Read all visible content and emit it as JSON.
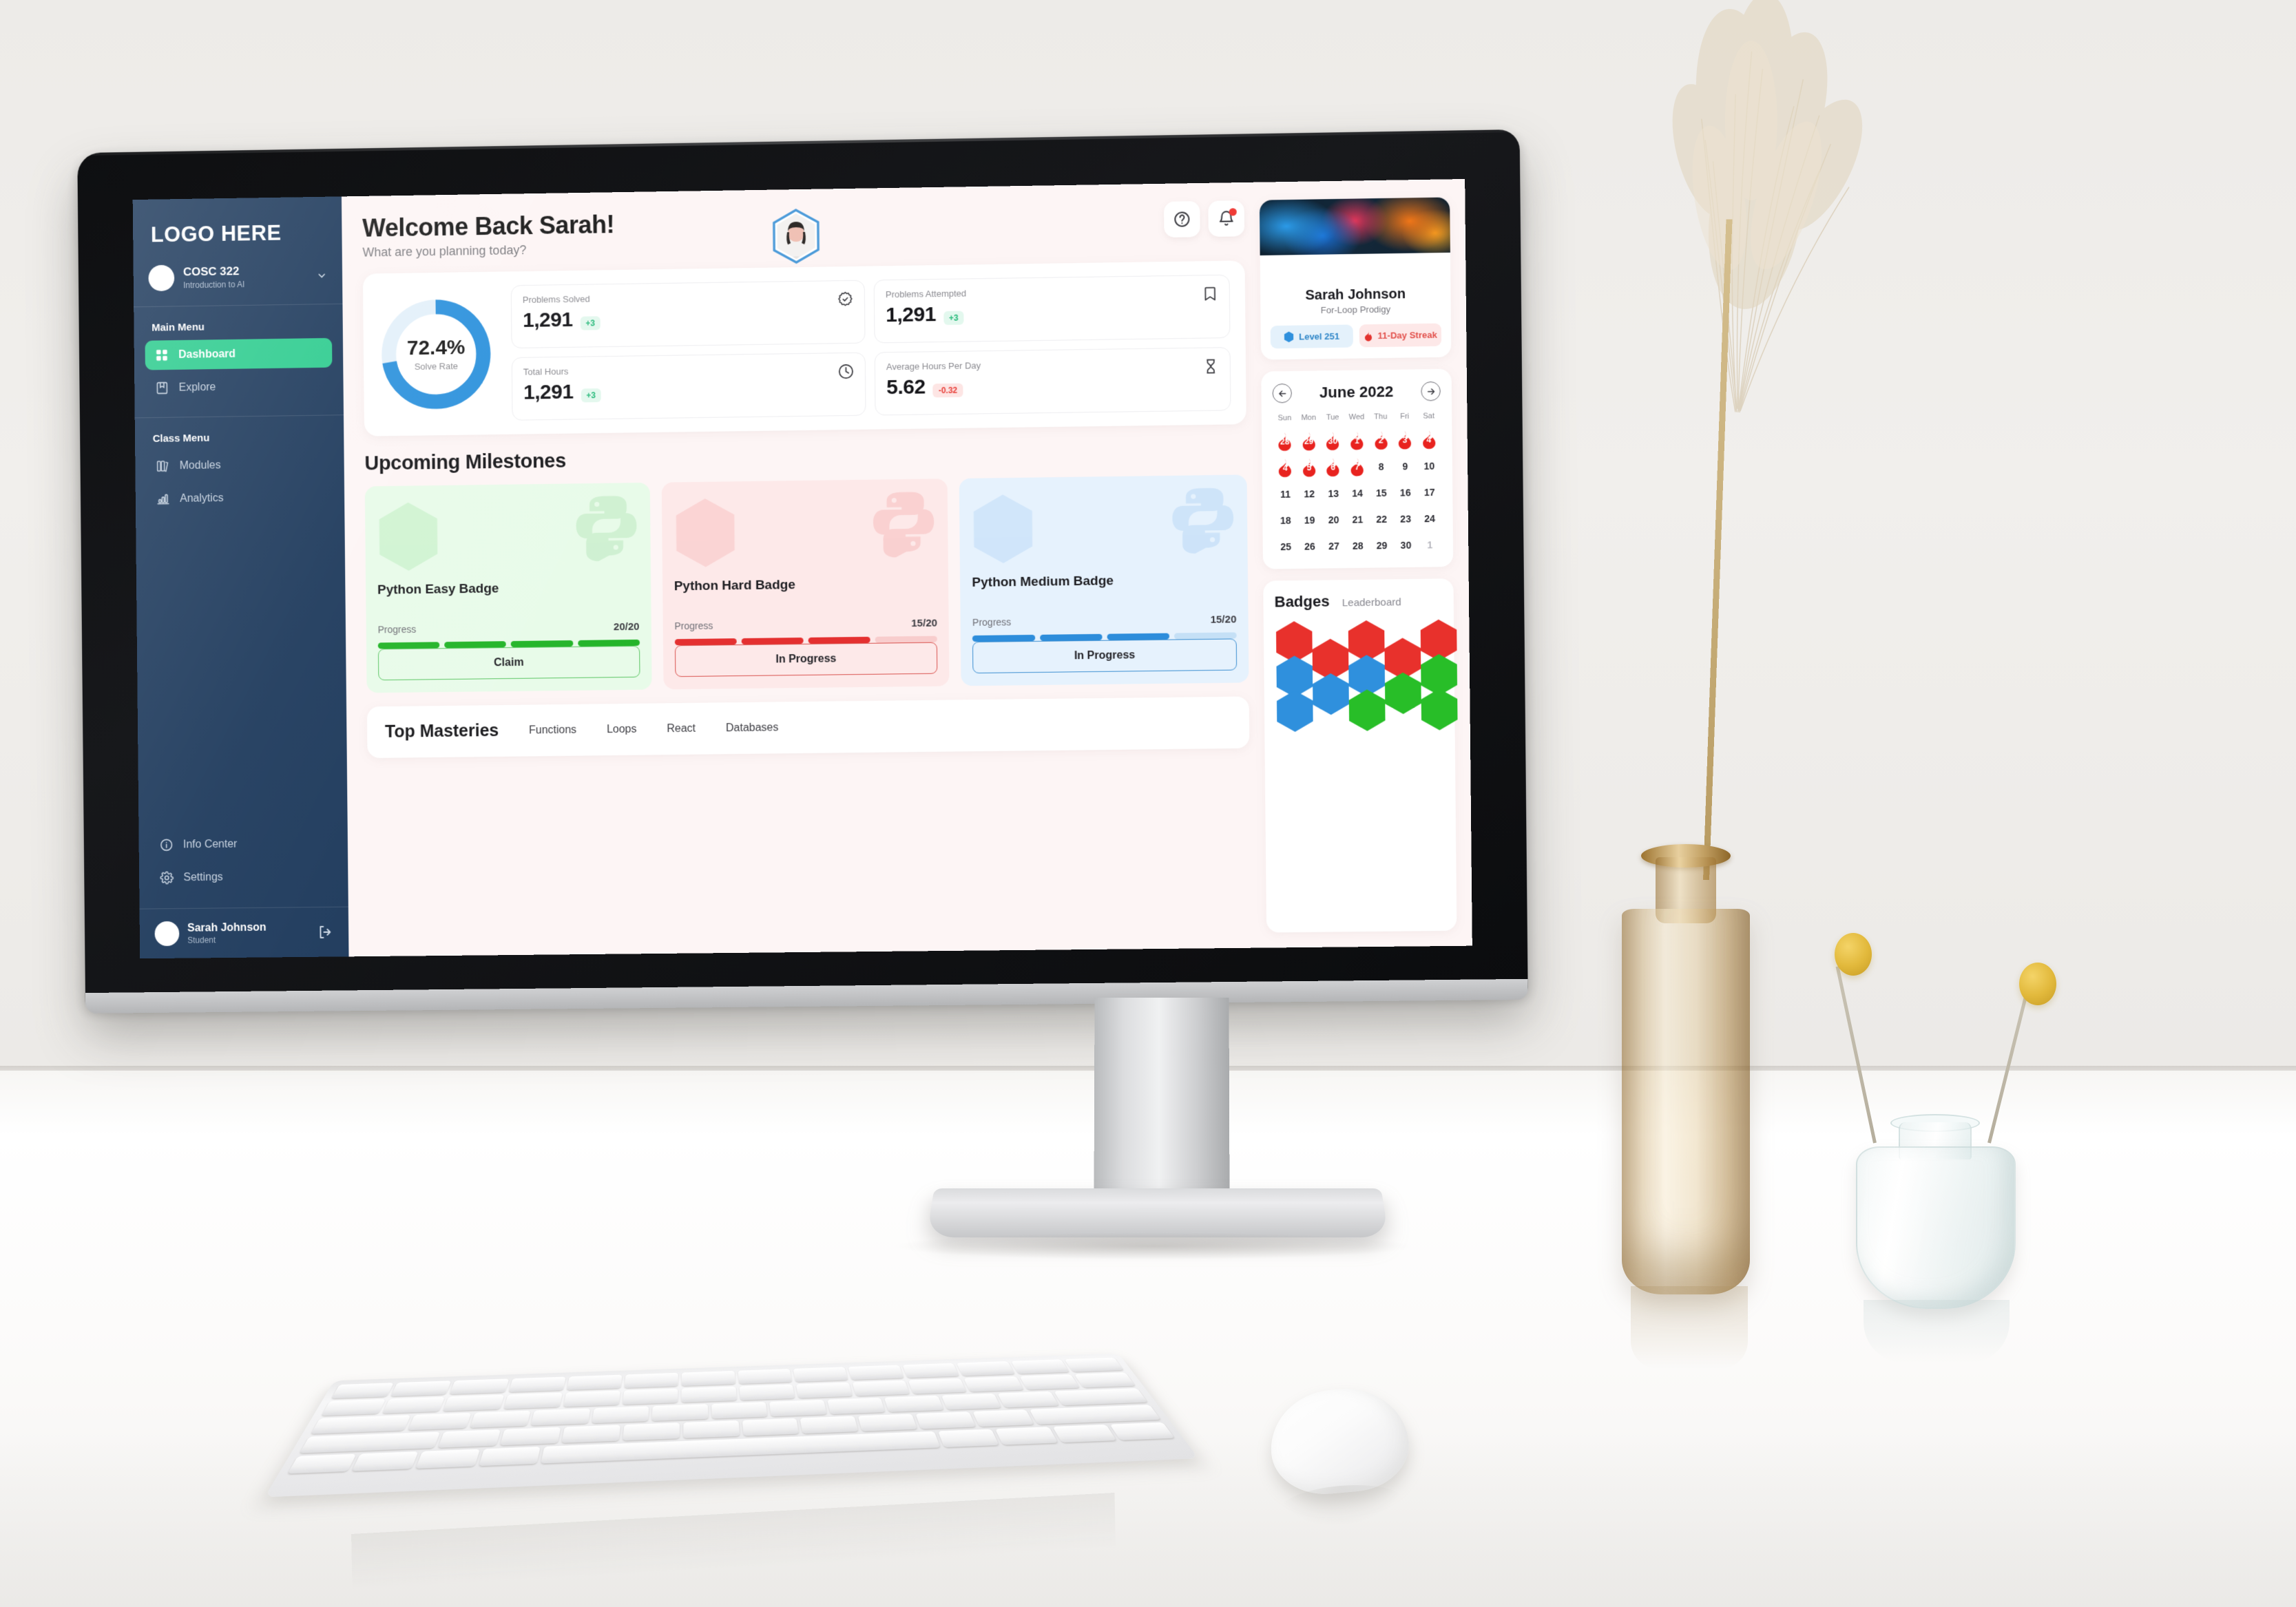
{
  "sidebar": {
    "logo": "LOGO HERE",
    "course": {
      "code": "COSC 322",
      "name": "Introduction to AI"
    },
    "sections": [
      {
        "title": "Main Menu",
        "items": [
          {
            "label": "Dashboard",
            "icon": "grid-icon",
            "active": true
          },
          {
            "label": "Explore",
            "icon": "book-bookmark-icon",
            "active": false
          }
        ]
      },
      {
        "title": "Class Menu",
        "items": [
          {
            "label": "Modules",
            "icon": "books-icon",
            "active": false
          },
          {
            "label": "Analytics",
            "icon": "bar-chart-icon",
            "active": false
          }
        ]
      }
    ],
    "bottom_items": [
      {
        "label": "Info Center",
        "icon": "info-icon"
      },
      {
        "label": "Settings",
        "icon": "gear-icon"
      }
    ],
    "user": {
      "name": "Sarah Johnson",
      "role": "Student"
    },
    "accent_active": "#2ecc8f",
    "bg": "#1e3a5c"
  },
  "header": {
    "title": "Welcome Back Sarah!",
    "subtitle": "What are you planning today?",
    "help_icon": "help-circle-icon",
    "notification_icon": "bell-icon",
    "has_notification": true
  },
  "stats": {
    "donut": {
      "value": "72.4%",
      "label": "Solve Rate",
      "percent": 72.4,
      "color": "#2f93dd",
      "track": "#e3f0fa"
    },
    "cards": [
      {
        "label": "Problems Solved",
        "value": "1,291",
        "delta": "+3",
        "delta_dir": "up",
        "icon": "verified-check-icon"
      },
      {
        "label": "Problems Attempted",
        "value": "1,291",
        "delta": "+3",
        "delta_dir": "up",
        "icon": "bookmark-icon"
      },
      {
        "label": "Total Hours",
        "value": "1,291",
        "delta": "+3",
        "delta_dir": "up",
        "icon": "clock-icon"
      },
      {
        "label": "Average Hours Per Day",
        "value": "5.62",
        "delta": "-0.32",
        "delta_dir": "down",
        "icon": "hourglass-icon"
      }
    ]
  },
  "milestones": {
    "title": "Upcoming Milestones",
    "cards": [
      {
        "name": "Python Easy Badge",
        "progress_label": "Progress",
        "progress_value": "20/20",
        "segments_total": 4,
        "segments_filled": 4,
        "button": "Claim",
        "bg": "#e8fbe9",
        "accent": "#22b428",
        "track": "#c9f0cb",
        "border": "#5bc563"
      },
      {
        "name": "Python Hard Badge",
        "progress_label": "Progress",
        "progress_value": "15/20",
        "segments_total": 4,
        "segments_filled": 3,
        "button": "In Progress",
        "bg": "#fde9e9",
        "accent": "#e43030",
        "track": "#f8cdcd",
        "border": "#d9534f"
      },
      {
        "name": "Python Medium Badge",
        "progress_label": "Progress",
        "progress_value": "15/20",
        "segments_total": 4,
        "segments_filled": 3,
        "button": "In Progress",
        "bg": "#e6f2fd",
        "accent": "#2d8ddb",
        "track": "#c5e0f6",
        "border": "#3d8fd1"
      }
    ]
  },
  "masteries": {
    "title": "Top Masteries",
    "items": [
      "Functions",
      "Loops",
      "React",
      "Databases"
    ]
  },
  "profile": {
    "name": "Sarah Johnson",
    "role": "For-Loop Prodigy",
    "badges": [
      {
        "label": "Level 251",
        "icon": "hex-level-icon",
        "color": "#2f86c8"
      },
      {
        "label": "11-Day Streak",
        "icon": "flame-icon",
        "color": "#e2504b"
      }
    ]
  },
  "calendar": {
    "month": "June 2022",
    "prev_icon": "arrow-left-icon",
    "next_icon": "arrow-right-icon",
    "dow": [
      "Sun",
      "Mon",
      "Tue",
      "Wed",
      "Thu",
      "Fri",
      "Sat"
    ],
    "weeks": [
      [
        {
          "d": "28",
          "fire": true,
          "muted": true
        },
        {
          "d": "29",
          "fire": true,
          "muted": true
        },
        {
          "d": "30",
          "fire": true,
          "muted": true
        },
        {
          "d": "1",
          "fire": true
        },
        {
          "d": "2",
          "fire": true
        },
        {
          "d": "3",
          "fire": true
        },
        {
          "d": "4",
          "fire": true
        }
      ],
      [
        {
          "d": "4",
          "fire": true
        },
        {
          "d": "5",
          "fire": true
        },
        {
          "d": "6",
          "fire": true
        },
        {
          "d": "7",
          "fire": true
        },
        {
          "d": "8"
        },
        {
          "d": "9"
        },
        {
          "d": "10"
        }
      ],
      [
        {
          "d": "11"
        },
        {
          "d": "12"
        },
        {
          "d": "13"
        },
        {
          "d": "14"
        },
        {
          "d": "15"
        },
        {
          "d": "16"
        },
        {
          "d": "17"
        }
      ],
      [
        {
          "d": "18"
        },
        {
          "d": "19"
        },
        {
          "d": "20"
        },
        {
          "d": "21"
        },
        {
          "d": "22"
        },
        {
          "d": "23"
        },
        {
          "d": "24"
        }
      ],
      [
        {
          "d": "25"
        },
        {
          "d": "26"
        },
        {
          "d": "27"
        },
        {
          "d": "28"
        },
        {
          "d": "29"
        },
        {
          "d": "30"
        },
        {
          "d": "1",
          "muted": true
        }
      ]
    ],
    "fire_color": "#e8231f"
  },
  "badges_panel": {
    "title": "Badges",
    "tab": "Leaderboard",
    "colors": {
      "red": "#e8312c",
      "blue": "#2f90dd",
      "green": "#28be28"
    },
    "hexes": [
      {
        "col": 0,
        "row": 0,
        "color": "red"
      },
      {
        "col": 1,
        "row": 0,
        "color": "red"
      },
      {
        "col": 2,
        "row": 0,
        "color": "red"
      },
      {
        "col": 3,
        "row": 0,
        "color": "red"
      },
      {
        "col": 4,
        "row": 0,
        "color": "red"
      },
      {
        "col": 0,
        "row": 1,
        "color": "blue"
      },
      {
        "col": 1,
        "row": 1,
        "color": "blue"
      },
      {
        "col": 2,
        "row": 1,
        "color": "blue"
      },
      {
        "col": 3,
        "row": 1,
        "color": "green"
      },
      {
        "col": 4,
        "row": 1,
        "color": "green"
      },
      {
        "col": 0,
        "row": 2,
        "color": "blue"
      },
      {
        "col": 2,
        "row": 2,
        "color": "green"
      },
      {
        "col": 4,
        "row": 2,
        "color": "green"
      }
    ]
  }
}
